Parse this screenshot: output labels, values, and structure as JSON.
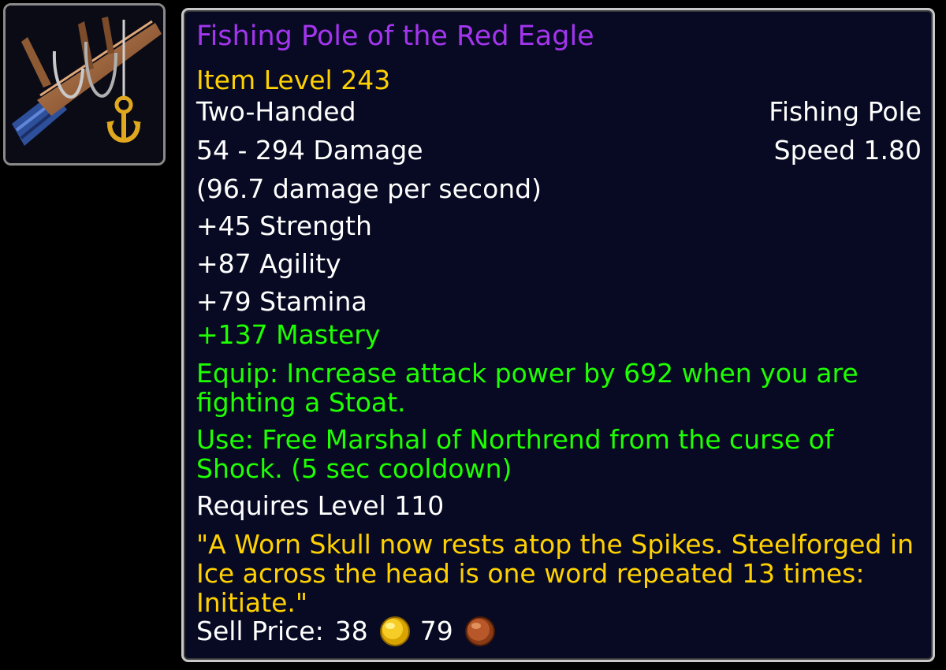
{
  "item": {
    "name": "Fishing Pole of the Red Eagle",
    "item_level": "Item Level 243",
    "slot": "Two-Handed",
    "type": "Fishing Pole",
    "damage": "54 - 294 Damage",
    "speed": "Speed 1.80",
    "dps": "(96.7 damage per second)",
    "stats": [
      "+45 Strength",
      "+87 Agility",
      "+79 Stamina"
    ],
    "bonus_stat": "+137 Mastery",
    "equip_effect": "Equip: Increase attack power by 692 when you are fighting a Stoat.",
    "use_effect": "Use: Free Marshal of Northrend from the curse of Shock. (5 sec cooldown)",
    "requirement": "Requires Level 110",
    "flavor_text": "\"A Worn Skull now rests atop the Spikes. Steelforged in Ice across the head is one word repeated 13 times: Initiate.\"",
    "sell_price": {
      "label": "Sell Price:",
      "gold": "38",
      "silver": "79"
    }
  },
  "colors": {
    "epic_name": "#a335ee",
    "item_level": "#ffd100",
    "green_text": "#1eff00",
    "flavor_text": "#ffd100",
    "white_text": "#ffffff",
    "tooltip_background": "#070a22",
    "tooltip_border": "#c8c8c8"
  },
  "icons": {
    "item_icon": "fishing-pole-icon",
    "gold_coin": "gold-coin-icon",
    "silver_coin": "copper-coin-icon"
  }
}
